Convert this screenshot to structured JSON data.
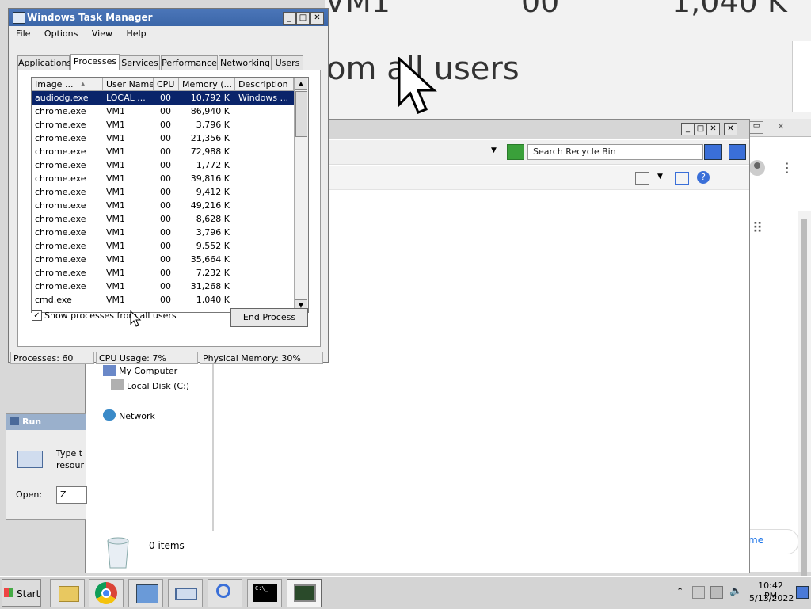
{
  "background_zoom": {
    "line1": "VM1",
    "line1_cpu": "00",
    "line1_mem": "1,040 K",
    "caption": "om all users"
  },
  "explorer": {
    "search_placeholder": "Search Recycle Bin",
    "nav": [
      "My Computer",
      "Local Disk (C:)",
      "Network"
    ],
    "status_items": "0 items"
  },
  "chrome": {
    "partial_text": "me"
  },
  "run_dialog": {
    "title": "Run",
    "desc_line1": "Type t",
    "desc_line2": "resour",
    "open_label": "Open:",
    "open_value": "Z"
  },
  "task_manager": {
    "title": "Windows Task Manager",
    "menu": [
      "File",
      "Options",
      "View",
      "Help"
    ],
    "tabs": [
      "Applications",
      "Processes",
      "Services",
      "Performance",
      "Networking",
      "Users"
    ],
    "active_tab": "Processes",
    "columns": [
      "Image ...",
      "User Name",
      "CPU",
      "Memory (...",
      "Description"
    ],
    "rows": [
      {
        "image": "audiodg.exe",
        "user": "LOCAL ...",
        "cpu": "00",
        "mem": "10,792 K",
        "desc": "Windows ..."
      },
      {
        "image": "chrome.exe",
        "user": "VM1",
        "cpu": "00",
        "mem": "86,940 K",
        "desc": ""
      },
      {
        "image": "chrome.exe",
        "user": "VM1",
        "cpu": "00",
        "mem": "3,796 K",
        "desc": ""
      },
      {
        "image": "chrome.exe",
        "user": "VM1",
        "cpu": "00",
        "mem": "21,356 K",
        "desc": ""
      },
      {
        "image": "chrome.exe",
        "user": "VM1",
        "cpu": "00",
        "mem": "72,988 K",
        "desc": ""
      },
      {
        "image": "chrome.exe",
        "user": "VM1",
        "cpu": "00",
        "mem": "1,772 K",
        "desc": ""
      },
      {
        "image": "chrome.exe",
        "user": "VM1",
        "cpu": "00",
        "mem": "39,816 K",
        "desc": ""
      },
      {
        "image": "chrome.exe",
        "user": "VM1",
        "cpu": "00",
        "mem": "9,412 K",
        "desc": ""
      },
      {
        "image": "chrome.exe",
        "user": "VM1",
        "cpu": "00",
        "mem": "49,216 K",
        "desc": ""
      },
      {
        "image": "chrome.exe",
        "user": "VM1",
        "cpu": "00",
        "mem": "8,628 K",
        "desc": ""
      },
      {
        "image": "chrome.exe",
        "user": "VM1",
        "cpu": "00",
        "mem": "3,796 K",
        "desc": ""
      },
      {
        "image": "chrome.exe",
        "user": "VM1",
        "cpu": "00",
        "mem": "9,552 K",
        "desc": ""
      },
      {
        "image": "chrome.exe",
        "user": "VM1",
        "cpu": "00",
        "mem": "35,664 K",
        "desc": ""
      },
      {
        "image": "chrome.exe",
        "user": "VM1",
        "cpu": "00",
        "mem": "7,232 K",
        "desc": ""
      },
      {
        "image": "chrome.exe",
        "user": "VM1",
        "cpu": "00",
        "mem": "31,268 K",
        "desc": ""
      },
      {
        "image": "cmd.exe",
        "user": "VM1",
        "cpu": "00",
        "mem": "1,040 K",
        "desc": ""
      }
    ],
    "show_all_label": "Show processes from all users",
    "show_all_checked": true,
    "end_process_label": "End Process",
    "status": {
      "processes": "Processes: 60",
      "cpu": "CPU Usage: 7%",
      "memory": "Physical Memory: 30%"
    }
  },
  "taskbar": {
    "start_label": "Start",
    "clock_time": "10:42 PM",
    "clock_date": "5/13/2022",
    "icons": [
      "explorer-icon",
      "chrome-icon",
      "control-panel-icon",
      "run-icon",
      "search-icon",
      "cmd-icon",
      "task-manager-icon"
    ]
  }
}
